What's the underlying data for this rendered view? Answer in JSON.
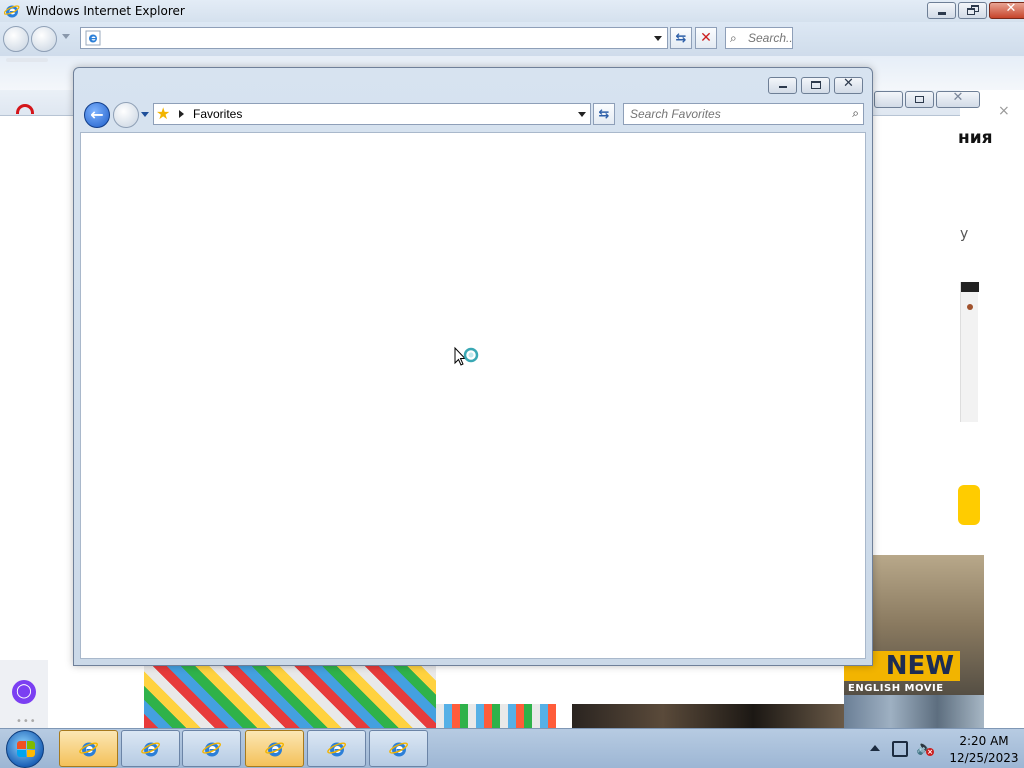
{
  "ie_window": {
    "title": "Windows Internet Explorer",
    "address_value": "",
    "search_placeholder": "Search...",
    "title_icon": "ie-logo-icon",
    "minimize_icon": "minimize-icon",
    "restore_icon": "restore-icon",
    "close_label": "✕",
    "refresh_label": "⇆",
    "stop_label": "✕",
    "search_glyph": "⌕"
  },
  "background_page": {
    "heading_fragment": "ния",
    "text_fragment": "у",
    "poster_title": "NEW",
    "poster_subtitle": "ENGLISH MOVIE",
    "close_glyph": "×",
    "alice_glyph": "◯",
    "alice_dots": "•••",
    "red_logo_color": "#d4151a"
  },
  "favorites_window": {
    "minimize_icon": "minimize-icon",
    "restore_icon": "restore-icon",
    "close_label": "✕",
    "back_label": "←",
    "breadcrumb": "Favorites",
    "star_glyph": "★",
    "refresh_label": "⇆",
    "search_placeholder": "Search Favorites",
    "search_glyph": "⌕"
  },
  "taskbar": {
    "start_icon": "windows-start-icon",
    "buttons": [
      {
        "icon": "ie-icon",
        "active": true
      },
      {
        "icon": "ie-icon",
        "active": false
      },
      {
        "icon": "ie-icon",
        "active": false
      },
      {
        "icon": "ie-icon",
        "active": true
      },
      {
        "icon": "ie-icon",
        "active": false
      },
      {
        "icon": "ie-icon",
        "active": false
      }
    ],
    "tray": {
      "time": "2:20 AM",
      "date": "12/25/2023",
      "volume_glyph": "🔈",
      "muted_glyph": "×"
    }
  },
  "colors": {
    "accent_blue": "#1e5dc8",
    "stop_red": "#cc1f1f",
    "star_gold": "#f2b400",
    "taskbar_active": "#f4c15a"
  }
}
